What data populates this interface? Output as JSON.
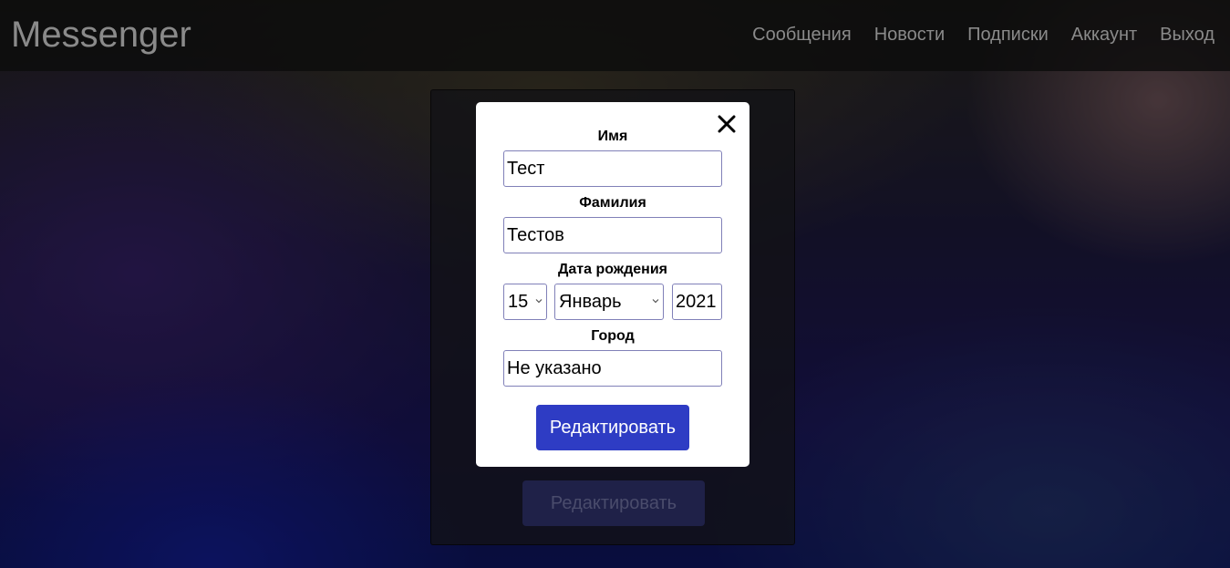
{
  "header": {
    "logo": "Messenger",
    "nav": [
      {
        "label": "Сообщения"
      },
      {
        "label": "Новости"
      },
      {
        "label": "Подписки"
      },
      {
        "label": "Аккаунт"
      },
      {
        "label": "Выход"
      }
    ]
  },
  "card": {
    "button_label": "Редактировать"
  },
  "modal": {
    "close_icon": "close-icon",
    "first_name": {
      "label": "Имя",
      "value": "Тест"
    },
    "last_name": {
      "label": "Фамилия",
      "value": "Тестов"
    },
    "birth_date": {
      "label": "Дата рождения",
      "day": "15",
      "month": "Январь",
      "year": "2021"
    },
    "city": {
      "label": "Город",
      "value": "Не указано"
    },
    "submit_label": "Редактировать"
  },
  "colors": {
    "accent": "#2e3cc4",
    "input_border": "#8080b8"
  }
}
